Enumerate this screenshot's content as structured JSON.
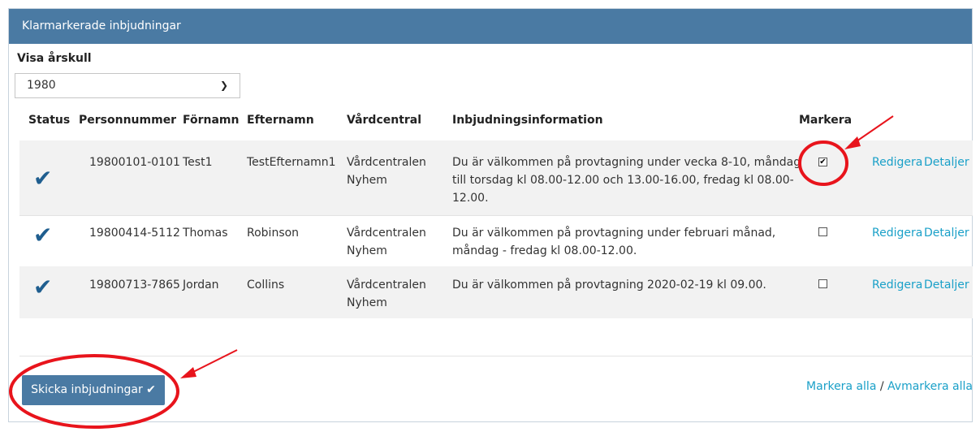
{
  "panel": {
    "title": "Klarmarkerade inbjudningar"
  },
  "filter": {
    "label": "Visa årskull",
    "selected_year": "1980",
    "chevron": "chevron-down-icon"
  },
  "table": {
    "headers": {
      "status": "Status",
      "personnummer": "Personnummer",
      "fornamn": "Förnamn",
      "efternamn": "Efternamn",
      "vardcentral": "Vårdcentral",
      "info": "Inbjudningsinformation",
      "markera": "Markera"
    },
    "rows": [
      {
        "status_icon": "checkmark-icon",
        "personnummer": "19800101-0101",
        "fornamn": "Test1",
        "efternamn": "TestEfternamn1",
        "vardcentral_1": "Vårdcentralen",
        "vardcentral_2": "Nyhem",
        "info_1": "Du är välkommen på provtagning under vecka 8-10, måndag",
        "info_2": "till torsdag kl 08.00-12.00 och 13.00-16.00, fredag kl 08.00-",
        "info_3": "12.00.",
        "marked": true,
        "edit": "Redigera",
        "details": "Detaljer"
      },
      {
        "status_icon": "checkmark-icon",
        "personnummer": "19800414-5112",
        "fornamn": "Thomas",
        "efternamn": "Robinson",
        "vardcentral_1": "Vårdcentralen",
        "vardcentral_2": "Nyhem",
        "info_1": "Du är välkommen på provtagning under februari månad,",
        "info_2": "måndag - fredag kl 08.00-12.00.",
        "info_3": "",
        "marked": false,
        "edit": "Redigera",
        "details": "Detaljer"
      },
      {
        "status_icon": "checkmark-icon",
        "personnummer": "19800713-7865",
        "fornamn": "Jordan",
        "efternamn": "Collins",
        "vardcentral_1": "Vårdcentralen",
        "vardcentral_2": "Nyhem",
        "info_1": "Du är välkommen på provtagning 2020-02-19 kl 09.00.",
        "info_2": "",
        "info_3": "",
        "marked": false,
        "edit": "Redigera",
        "details": "Detaljer"
      }
    ]
  },
  "footer": {
    "send_button": "Skicka inbjudningar",
    "send_icon": "checkmark-icon",
    "mark_all": "Markera alla",
    "separator": "/",
    "unmark_all": "Avmarkera alla"
  },
  "colors": {
    "header_bg": "#4a7aa3",
    "link": "#1aa0c8",
    "status_check": "#1f5e8f",
    "annotation": "#e8141c"
  }
}
